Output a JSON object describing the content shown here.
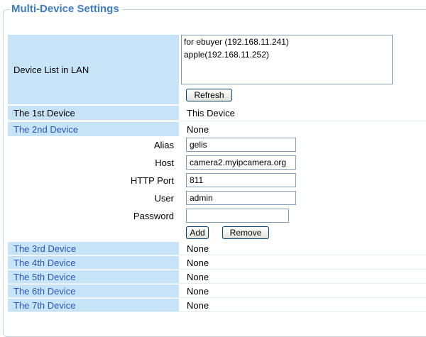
{
  "title": "Multi-Device Settings",
  "device_list_label": "Device List in LAN",
  "lan_devices": [
    "for ebuyer (192.168.11.241)",
    "apple(192.168.11.252)"
  ],
  "refresh_label": "Refresh",
  "first_device": {
    "label": "The 1st Device",
    "value": "This Device"
  },
  "second_device": {
    "label": "The 2nd Device",
    "value": "None"
  },
  "form": {
    "alias_label": "Alias",
    "alias_value": "gelis",
    "host_label": "Host",
    "host_value": "camera2.myipcamera.org",
    "port_label": "HTTP Port",
    "port_value": "811",
    "user_label": "User",
    "user_value": "admin",
    "password_label": "Password",
    "password_value": ""
  },
  "add_label": "Add",
  "remove_label": "Remove",
  "other_devices": [
    {
      "label": "The 3rd Device",
      "value": "None"
    },
    {
      "label": "The 4th Device",
      "value": "None"
    },
    {
      "label": "The 5th Device",
      "value": "None"
    },
    {
      "label": "The 6th Device",
      "value": "None"
    },
    {
      "label": "The 7th Device",
      "value": "None"
    }
  ]
}
